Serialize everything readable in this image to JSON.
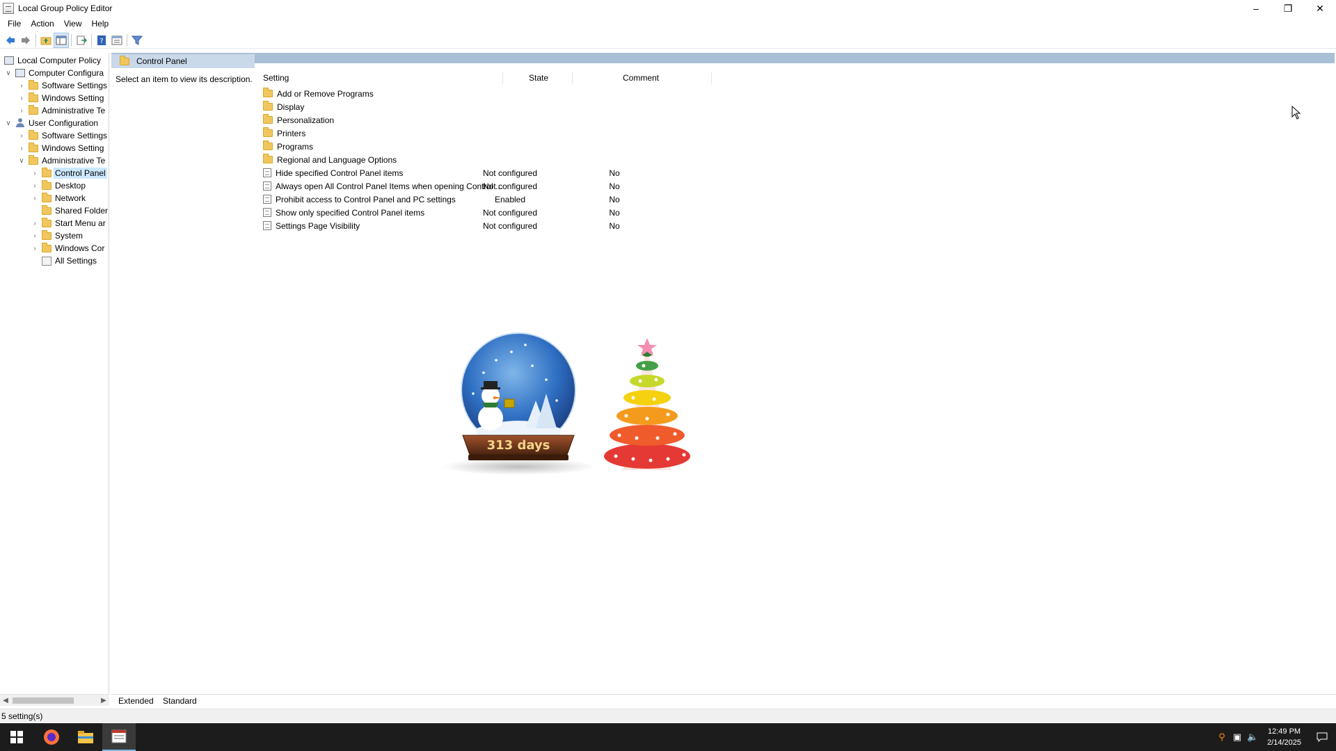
{
  "window": {
    "title": "Local Group Policy Editor",
    "minimize_label": "–",
    "restore_label": "❐",
    "close_label": "✕"
  },
  "menu": {
    "file": "File",
    "action": "Action",
    "view": "View",
    "help": "Help"
  },
  "toolbar": {
    "icons": [
      "back-icon",
      "forward-icon",
      "up-one-level-icon",
      "show-hide-console-tree-icon",
      "export-list-icon",
      "help-icon",
      "properties-icon",
      "filter-icon"
    ]
  },
  "tree": {
    "root": "Local Computer Policy",
    "computer_configuration": "Computer Configura",
    "cc_software_settings": "Software Settings",
    "cc_windows_settings": "Windows Setting",
    "cc_admin_templates": "Administrative Te",
    "user_configuration": "User Configuration",
    "uc_software_settings": "Software Settings",
    "uc_windows_settings": "Windows Setting",
    "uc_admin_templates": "Administrative Te",
    "control_panel": "Control Panel",
    "desktop": "Desktop",
    "network": "Network",
    "shared_folders": "Shared Folder",
    "start_menu": "Start Menu ar",
    "system": "System",
    "windows_components": "Windows Cor",
    "all_settings": "All Settings"
  },
  "main": {
    "header_title": "Control Panel",
    "description": "Select an item to view its description.",
    "columns": {
      "setting": "Setting",
      "state": "State",
      "comment": "Comment"
    },
    "folders": [
      "Add or Remove Programs",
      "Display",
      "Personalization",
      "Printers",
      "Programs",
      "Regional and Language Options"
    ],
    "policies": [
      {
        "name": "Hide specified Control Panel items",
        "state": "Not configured",
        "comment": "No"
      },
      {
        "name": "Always open All Control Panel Items when opening Control ...",
        "state": "Not configured",
        "comment": "No"
      },
      {
        "name": "Prohibit access to Control Panel and PC settings",
        "state": "Enabled",
        "comment": "No"
      },
      {
        "name": "Show only specified Control Panel items",
        "state": "Not configured",
        "comment": "No"
      },
      {
        "name": "Settings Page Visibility",
        "state": "Not configured",
        "comment": "No"
      }
    ]
  },
  "widget": {
    "countdown_text": "313 days"
  },
  "view_tabs": {
    "extended": "Extended",
    "standard": "Standard"
  },
  "status": {
    "text": "5 setting(s)"
  },
  "taskbar": {
    "time": "12:49 PM",
    "date": "2/14/2025"
  },
  "colors": {
    "header_band": "#a8bfd6",
    "selection": "#cce8ff",
    "taskbar": "#1c1c1c"
  }
}
